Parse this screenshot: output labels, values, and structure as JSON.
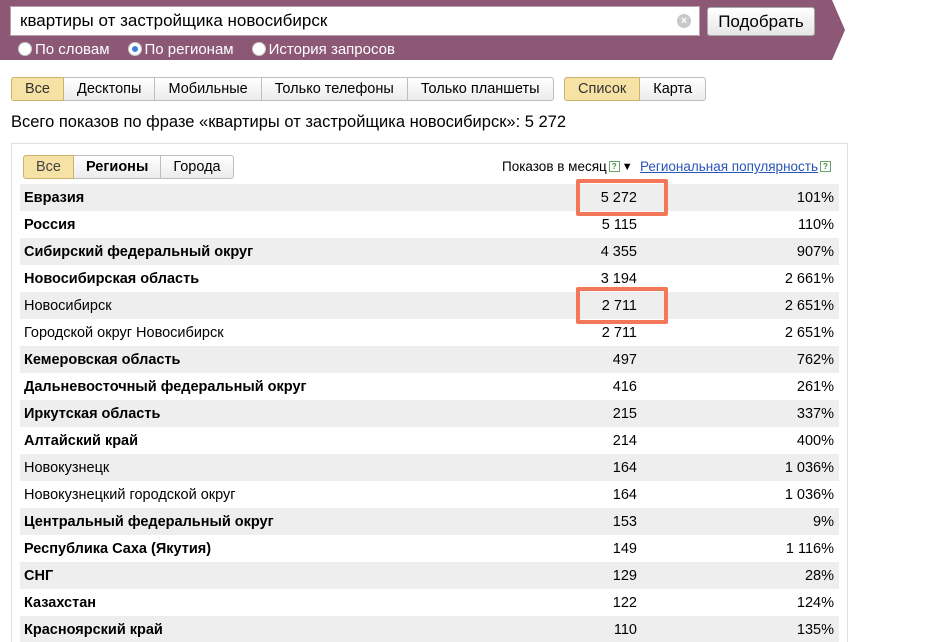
{
  "search": {
    "query": "квартиры от застройщика новосибирск",
    "button_label": "Подобрать",
    "modes": [
      {
        "label": "По словам",
        "checked": false
      },
      {
        "label": "По регионам",
        "checked": true
      },
      {
        "label": "История запросов",
        "checked": false
      }
    ]
  },
  "device_filter": [
    "Все",
    "Десктопы",
    "Мобильные",
    "Только телефоны",
    "Только планшеты"
  ],
  "device_filter_active": "Все",
  "view_toggle": [
    "Список",
    "Карта"
  ],
  "view_toggle_active": "Список",
  "total_line": "Всего показов по фразе «квартиры от застройщика новосибирск»: 5 272",
  "table": {
    "tabs": [
      "Все",
      "Регионы",
      "Города"
    ],
    "columns": {
      "shows": "Показов в месяц",
      "popularity": "Региональная популярность"
    },
    "rows": [
      {
        "name": "Евразия",
        "shows": "5 272",
        "popularity": "101%",
        "bold": true
      },
      {
        "name": "Россия",
        "shows": "5 115",
        "popularity": "110%",
        "bold": true
      },
      {
        "name": "Сибирский федеральный округ",
        "shows": "4 355",
        "popularity": "907%",
        "bold": true
      },
      {
        "name": "Новосибирская область",
        "shows": "3 194",
        "popularity": "2 661%",
        "bold": true
      },
      {
        "name": "Новосибирск",
        "shows": "2 711",
        "popularity": "2 651%",
        "bold": false
      },
      {
        "name": "Городской округ Новосибирск",
        "shows": "2 711",
        "popularity": "2 651%",
        "bold": false
      },
      {
        "name": "Кемеровская область",
        "shows": "497",
        "popularity": "762%",
        "bold": true
      },
      {
        "name": "Дальневосточный федеральный округ",
        "shows": "416",
        "popularity": "261%",
        "bold": true
      },
      {
        "name": "Иркутская область",
        "shows": "215",
        "popularity": "337%",
        "bold": true
      },
      {
        "name": "Алтайский край",
        "shows": "214",
        "popularity": "400%",
        "bold": true
      },
      {
        "name": "Новокузнецк",
        "shows": "164",
        "popularity": "1 036%",
        "bold": false
      },
      {
        "name": "Новокузнецкий городской округ",
        "shows": "164",
        "popularity": "1 036%",
        "bold": false
      },
      {
        "name": "Центральный федеральный округ",
        "shows": "153",
        "popularity": "9%",
        "bold": true
      },
      {
        "name": "Республика Саха (Якутия)",
        "shows": "149",
        "popularity": "1 116%",
        "bold": true
      },
      {
        "name": "СНГ",
        "shows": "129",
        "popularity": "28%",
        "bold": true
      },
      {
        "name": "Казахстан",
        "shows": "122",
        "popularity": "124%",
        "bold": true
      },
      {
        "name": "Красноярский край",
        "shows": "110",
        "popularity": "135%",
        "bold": true
      }
    ],
    "highlighted_rows": [
      0,
      4
    ]
  },
  "colors": {
    "header_band": "#8c5876",
    "active_button": "#f6e2a4",
    "highlight_box": "#f37859",
    "link": "#2a55b8"
  }
}
